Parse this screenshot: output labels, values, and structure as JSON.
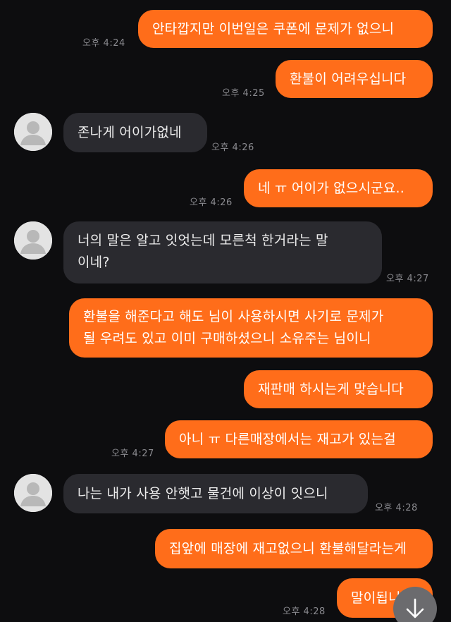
{
  "messages": [
    {
      "side": "mine",
      "text": "안타깝지만 이번일은 쿠폰에 문제가 없으니",
      "time": "오후 4:24"
    },
    {
      "side": "mine",
      "text": "환불이 어려우십니다",
      "time": "오후 4:25"
    },
    {
      "side": "theirs",
      "text": "존나게 어이가없네",
      "time": "오후 4:26"
    },
    {
      "side": "mine",
      "text": "네 ㅠ 어이가 없으시군요..",
      "time": "오후 4:26"
    },
    {
      "side": "theirs",
      "text": "너의 말은 알고 잇엇는데 모른척 한거라는 말\n이네?",
      "time": "오후 4:27"
    },
    {
      "side": "mine",
      "text": "환불을 해준다고 해도 님이 사용하시면 사기로 문제가\n될 우려도 있고 이미 구매하셨으니 소유주는 님이니",
      "time": ""
    },
    {
      "side": "mine",
      "text": "재판매 하시는게 맞습니다",
      "time": ""
    },
    {
      "side": "mine",
      "text": "아니 ㅠ 다른매장에서는 재고가 있는걸",
      "time": "오후 4:27"
    },
    {
      "side": "theirs",
      "text": "나는 내가 사용 안햇고 물건에 이상이 잇으니",
      "time": "오후 4:28"
    },
    {
      "side": "mine",
      "text": "집앞에 매장에 재고없으니 환불해달라는게",
      "time": ""
    },
    {
      "side": "mine",
      "text": "말이됩니",
      "time": "오후 4:28"
    }
  ],
  "colors": {
    "background": "#0d0d0f",
    "mine_bubble": "#ff6d1a",
    "theirs_bubble": "#2a2a2f",
    "timestamp": "#8a8a8f"
  },
  "icons": {
    "avatar": "default-person-icon",
    "scroll": "arrow-down-icon"
  }
}
